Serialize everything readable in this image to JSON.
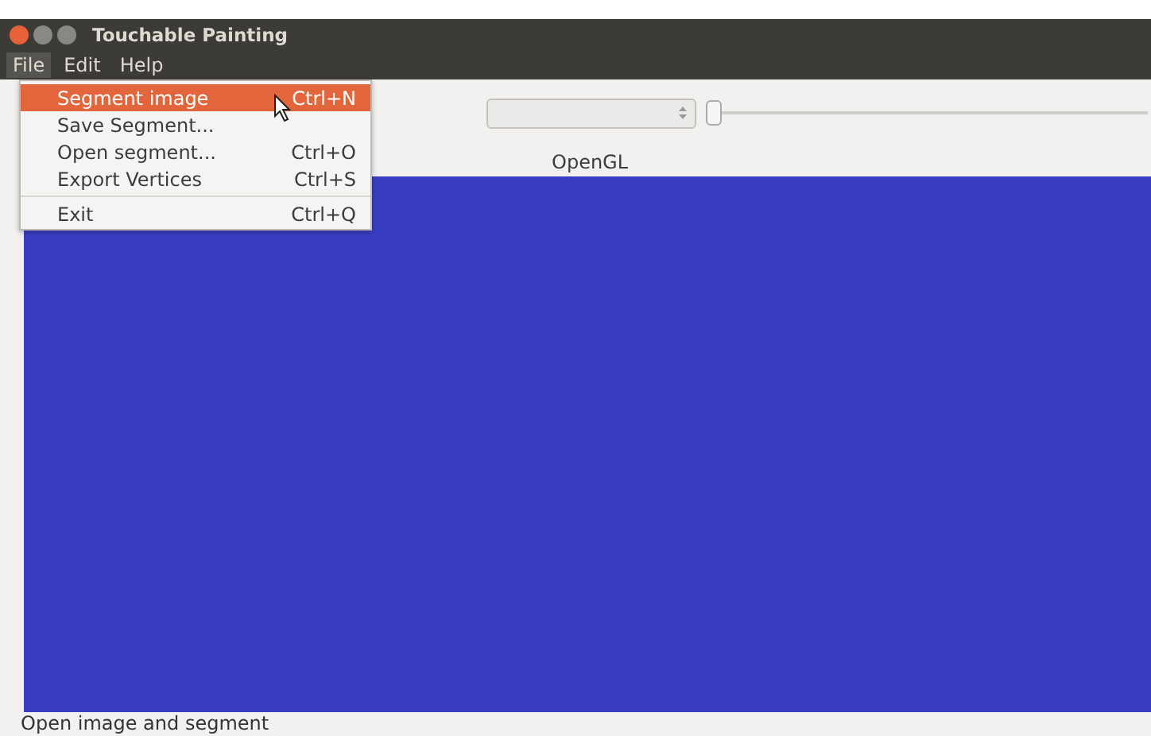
{
  "window": {
    "title": "Touchable Painting"
  },
  "menubar": [
    {
      "label": "File",
      "selected": true
    },
    {
      "label": "Edit",
      "selected": false
    },
    {
      "label": "Help",
      "selected": false
    }
  ],
  "file_menu": [
    {
      "kind": "item",
      "label": "Segment image",
      "shortcut": "Ctrl+N",
      "selected": true
    },
    {
      "kind": "item",
      "label": "Save Segment...",
      "selected": false
    },
    {
      "kind": "item",
      "label": "Open segment...",
      "shortcut": "Ctrl+O",
      "selected": false
    },
    {
      "kind": "item",
      "label": "Export Vertices",
      "shortcut": "Ctrl+S",
      "selected": false
    },
    {
      "kind": "separator"
    },
    {
      "kind": "item",
      "label": "Exit",
      "shortcut": "Ctrl+Q",
      "selected": false
    }
  ],
  "toolbar": {
    "slider": {
      "level": 0
    }
  },
  "canvas": {
    "label": "OpenGL",
    "color": "#3a3dc2"
  },
  "status_bar": "Open image and segment"
}
